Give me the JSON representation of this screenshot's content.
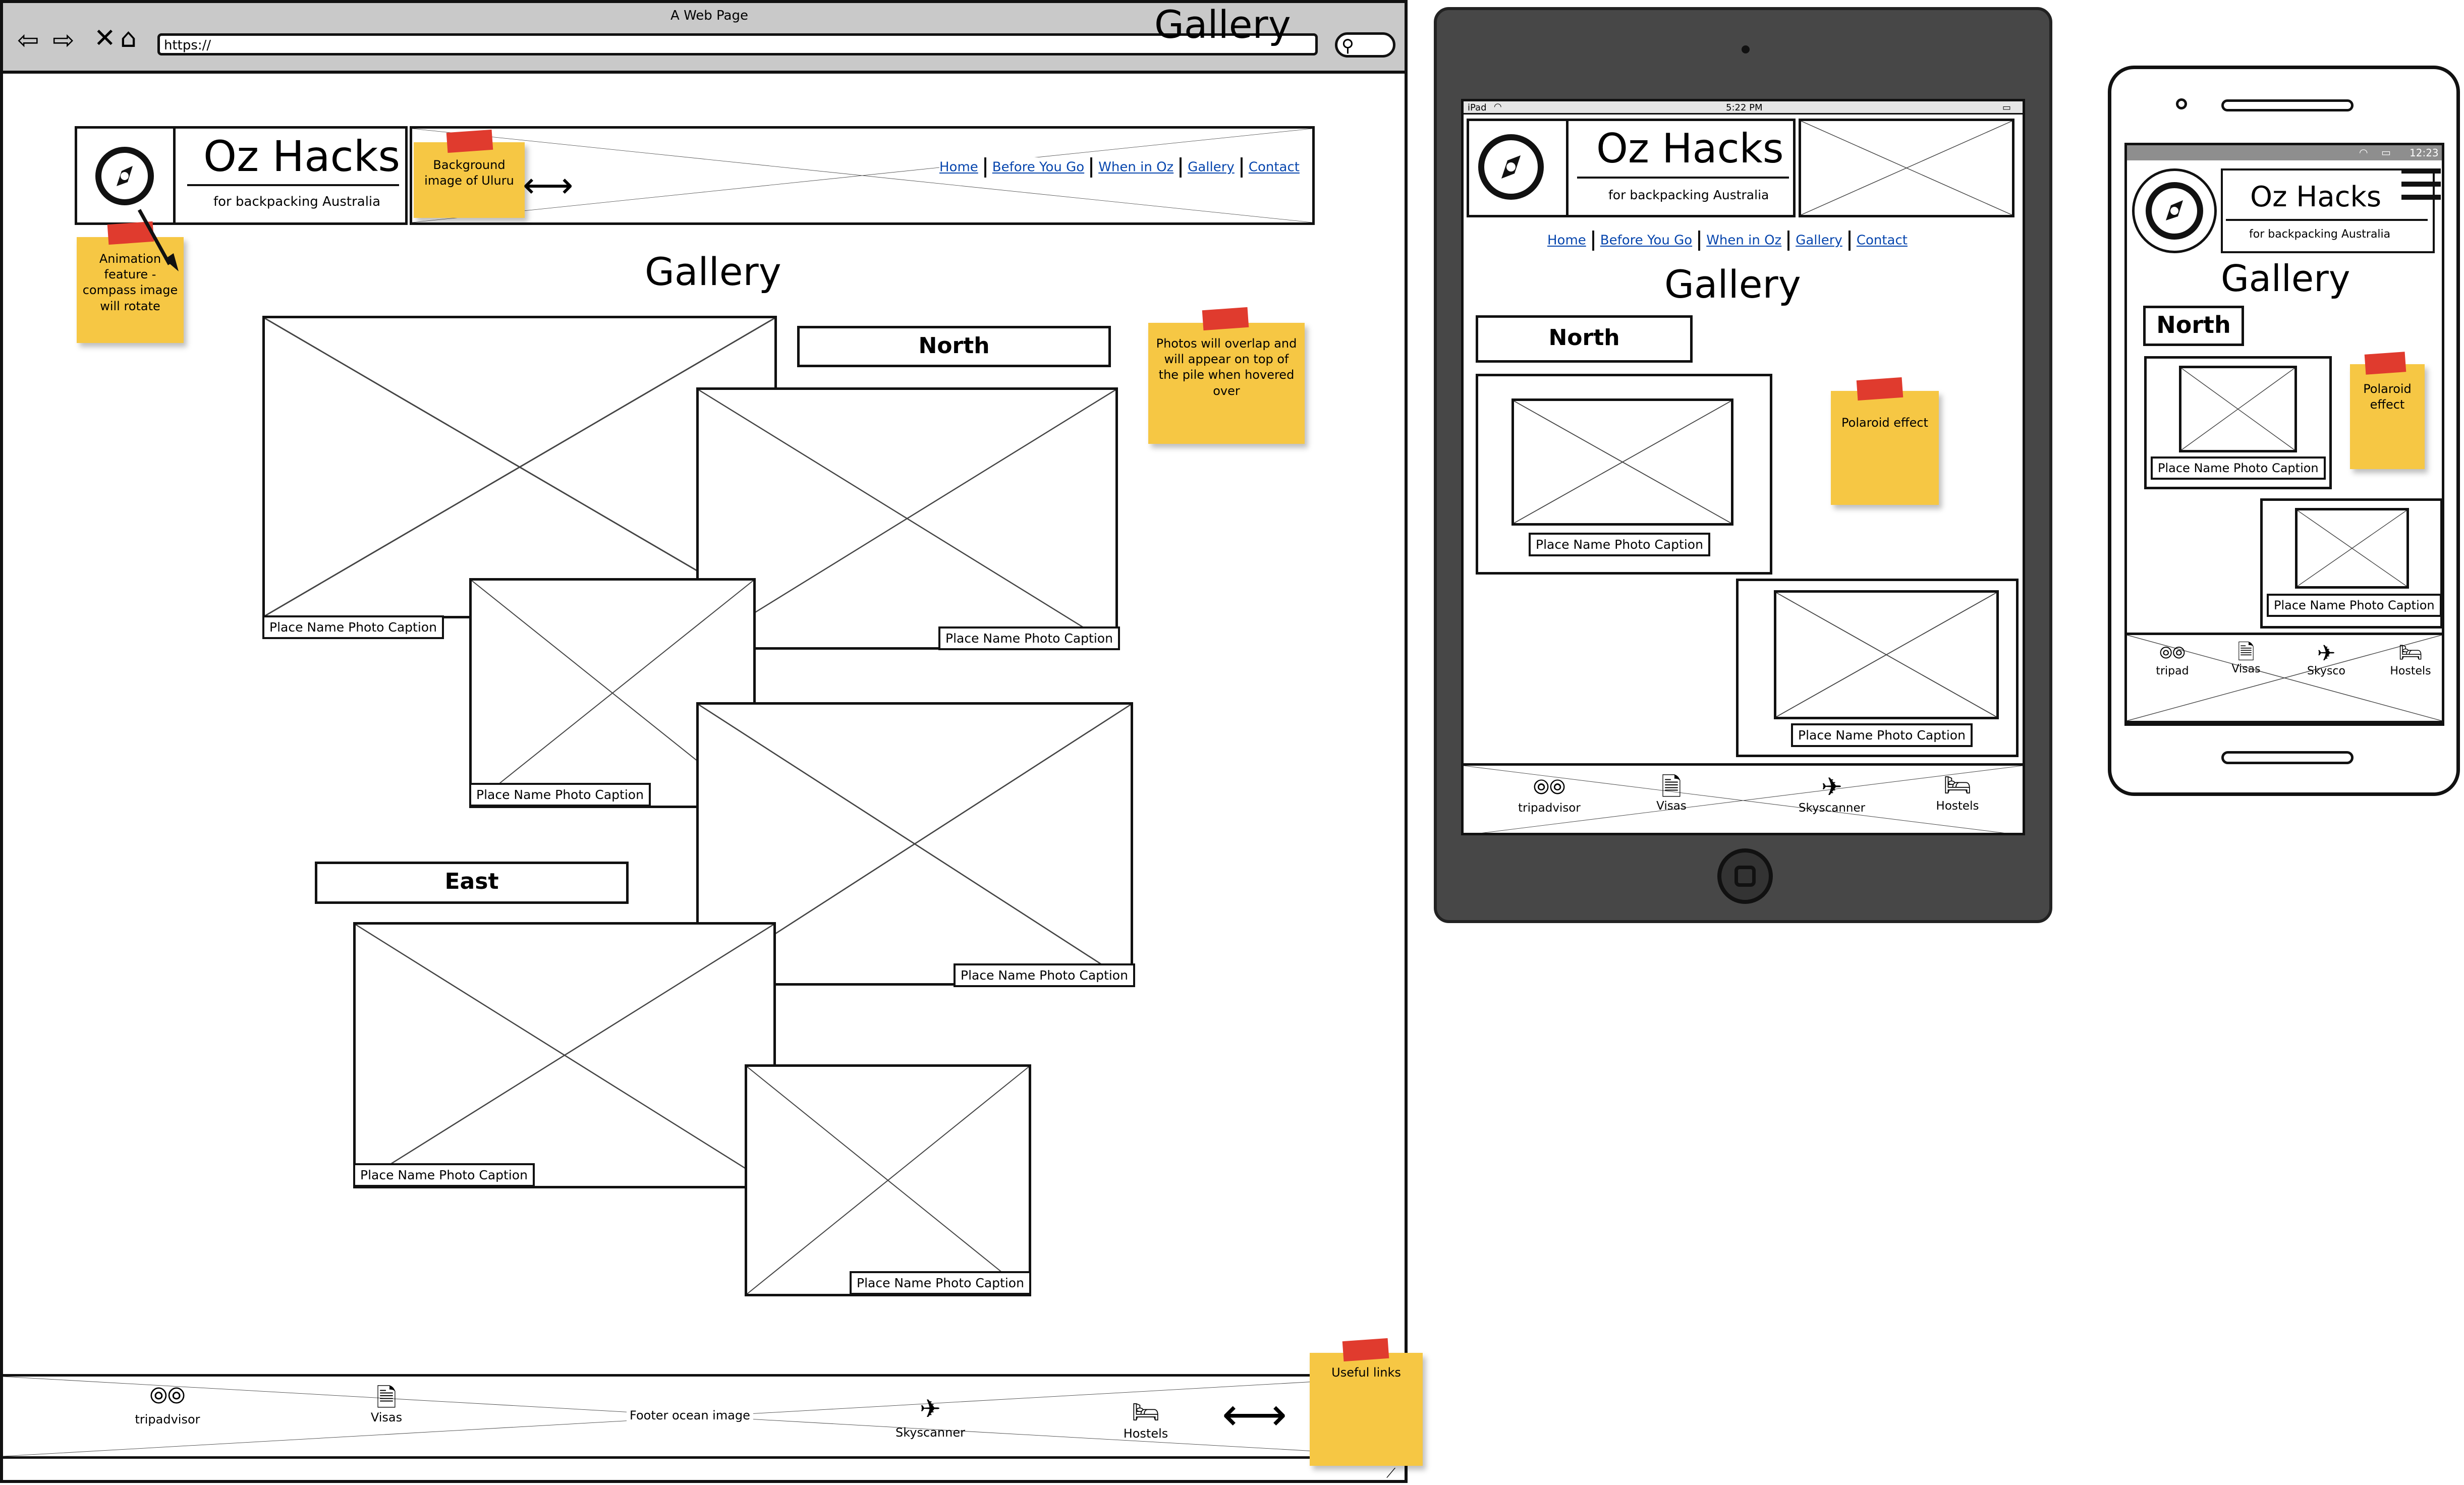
{
  "browser": {
    "window_title": "A Web Page",
    "url": "https://",
    "overlay_title": "Gallery"
  },
  "site": {
    "logo_title": "Oz Hacks",
    "logo_subtitle": "for backpacking Australia",
    "nav": [
      "Home",
      "Before You Go",
      "When in Oz",
      "Gallery",
      "Contact"
    ],
    "page_title": "Gallery"
  },
  "desktop": {
    "sections": [
      "North",
      "East"
    ],
    "caption": "Place Name Photo Caption",
    "footer_label": "Footer ocean image",
    "footer_links": [
      "tripadvisor",
      "Visas",
      "Skyscanner",
      "Hostels"
    ],
    "notes": {
      "banner": "Background image of Uluru",
      "animation": "Animation feature - compass image will rotate",
      "photos": "Photos will overlap and will appear on top of the pile when hovered over",
      "links": "Useful links"
    }
  },
  "tablet": {
    "status_left": "iPad",
    "status_time": "5:22 PM",
    "section": "North",
    "caption": "Place Name Photo Caption",
    "note": "Polaroid effect",
    "footer_links": [
      "tripadvisor",
      "Visas",
      "Skyscanner",
      "Hostels"
    ]
  },
  "phone": {
    "status_time": "12:23",
    "section": "North",
    "caption": "Place Name Photo Caption",
    "note": "Polaroid effect",
    "footer_links": [
      "tripad",
      "Visas",
      "Skysco",
      "Hostels"
    ]
  },
  "colors": {
    "sticky": "#f6c744",
    "tape": "#e03b2e",
    "link": "#0645ad",
    "device_frame": "#474747"
  },
  "icons": [
    "back-arrow-icon",
    "forward-arrow-icon",
    "close-icon",
    "home-icon",
    "search-icon",
    "compass-icon",
    "tripadvisor-icon",
    "document-icon",
    "airplane-icon",
    "bed-icon",
    "hamburger-menu-icon",
    "wifi-icon",
    "battery-icon"
  ]
}
